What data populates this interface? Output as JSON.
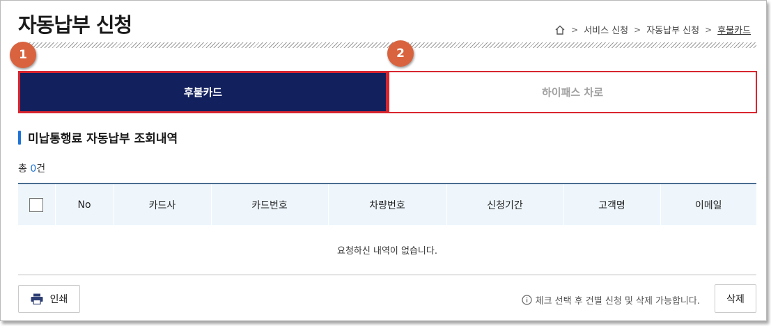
{
  "page": {
    "title": "자동납부 신청"
  },
  "breadcrumb": {
    "home_icon": "home-icon",
    "items": [
      "서비스 신청",
      "자동납부 신청",
      "후불카드"
    ]
  },
  "steps": [
    "1",
    "2"
  ],
  "tabs": [
    {
      "label": "후불카드",
      "active": true
    },
    {
      "label": "하이패스 차로",
      "active": false
    }
  ],
  "section": {
    "title": "미납통행료 자동납부 조회내역"
  },
  "summary": {
    "prefix": "총 ",
    "count": "0",
    "suffix": "건"
  },
  "table": {
    "columns": [
      "No",
      "카드사",
      "카드번호",
      "차량번호",
      "신청기간",
      "고객명",
      "이메일"
    ],
    "empty_message": "요청하신 내역이 없습니다."
  },
  "footer": {
    "print_label": "인쇄",
    "notice": "체크 선택 후 건별 신청 및 삭제 가능합니다.",
    "delete_label": "삭제"
  },
  "colors": {
    "active_tab_bg": "#12205e",
    "highlight_border": "#d8262f",
    "badge": "#d9633f",
    "accent_blue": "#1e74d6",
    "table_header_bg": "#eef6fc"
  }
}
